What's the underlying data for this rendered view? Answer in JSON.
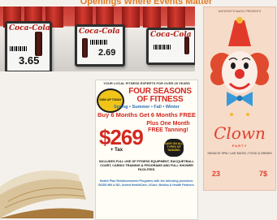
{
  "header": {
    "title": "Openings Where Events Matter"
  },
  "shelf": {
    "labels": [
      {
        "brand": "Coca-Cola",
        "price": "3.65"
      },
      {
        "brand": "Coca-Cola",
        "price": "2.69"
      },
      {
        "brand": "Coca-Cola",
        "price": ""
      }
    ]
  },
  "fitness": {
    "top_line": "YOUR LOCAL FITNESS EXPERTS FOR OVER 25 YEARS",
    "burst": "SIGN UP TODAY",
    "headline": "FOUR SEASONS OF FITNESS",
    "seasons": "Spring • Summer • Fall • Winter",
    "deal": "Buy 6 Months Get 6 Months FREE",
    "plus": "Plus One Month FREE Tanning!",
    "price": "$269",
    "tax": "+ Tax",
    "badge": "SAVE ON ALL TYPES OF TANNING",
    "includes": "INCLUDES FULL USE OF FITNESS EQUIPMENT, RACQUETBALL COURT, CARDIO TRAINING & PROGRAMS AND FULL SHOWER FACILITIES.",
    "footer": "Health Plan Reimbursement Programs with the following providers: BCBS MN & ND, United HealthCare, UCare, Medica & Health Partners."
  },
  "clown": {
    "top_line": "ANTHONY'S MAGIC PRESENTS",
    "title": "Clown",
    "subtitle": "PARTY",
    "info": "SHOW AT 9PM / LIVE MUSIC / FOOD & DRINKS",
    "date_left": "23",
    "date_right": "7$"
  },
  "colors": {
    "accent": "#d2281f",
    "blue": "#2d6fb5",
    "clown_red": "#e0402c",
    "poster_bg": "#f6dbc9"
  }
}
